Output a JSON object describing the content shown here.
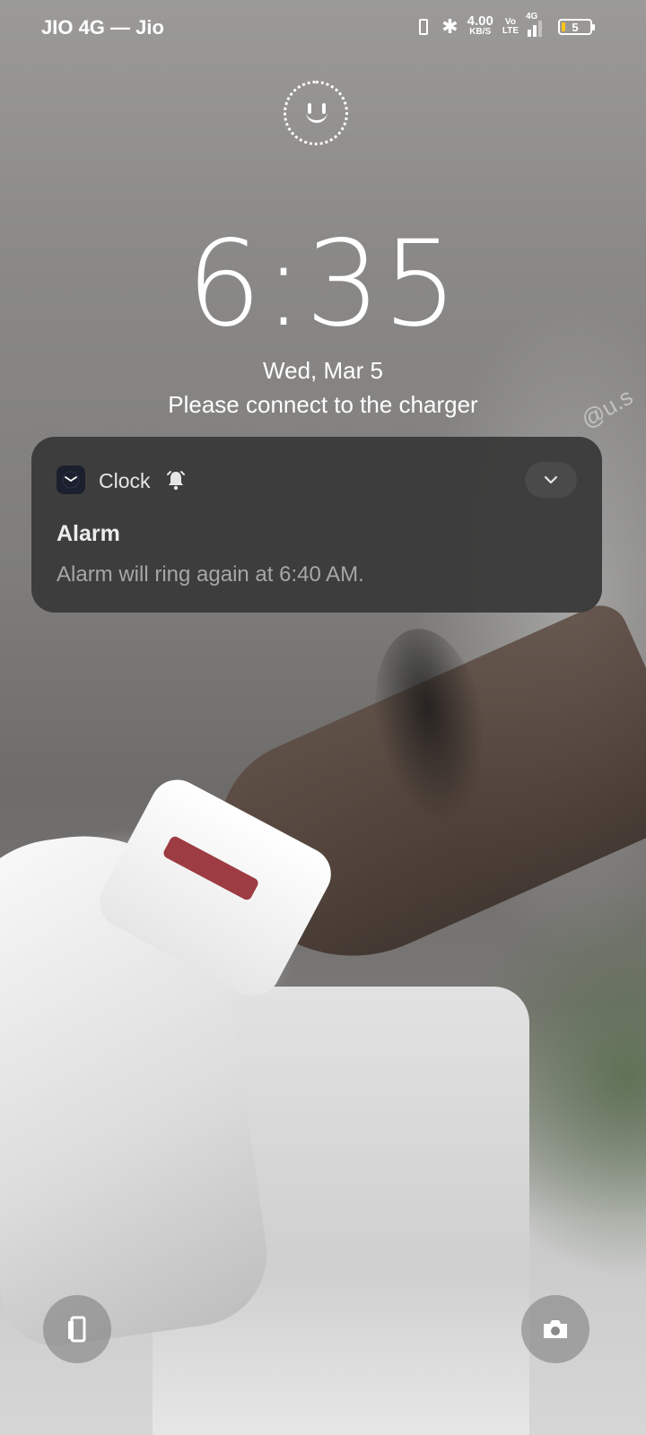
{
  "status_bar": {
    "carrier": "JIO 4G — Jio",
    "speed_value": "4.00",
    "speed_unit": "KB/S",
    "volte_top": "Vo",
    "volte_bottom": "LTE",
    "network_type": "4G",
    "battery_level": "5",
    "battery_color": "#f5c518"
  },
  "lock_screen": {
    "time": "6:35",
    "date": "Wed, Mar 5",
    "charge_message": "Please connect to the charger"
  },
  "notification": {
    "app_name": "Clock",
    "app_icon": "clock-app-icon",
    "title": "Alarm",
    "body": "Alarm will ring again at 6:40 AM."
  },
  "shortcuts": {
    "left_icon": "wallet-icon",
    "right_icon": "camera-icon"
  },
  "wallpaper": {
    "watermark": "@u.s"
  }
}
